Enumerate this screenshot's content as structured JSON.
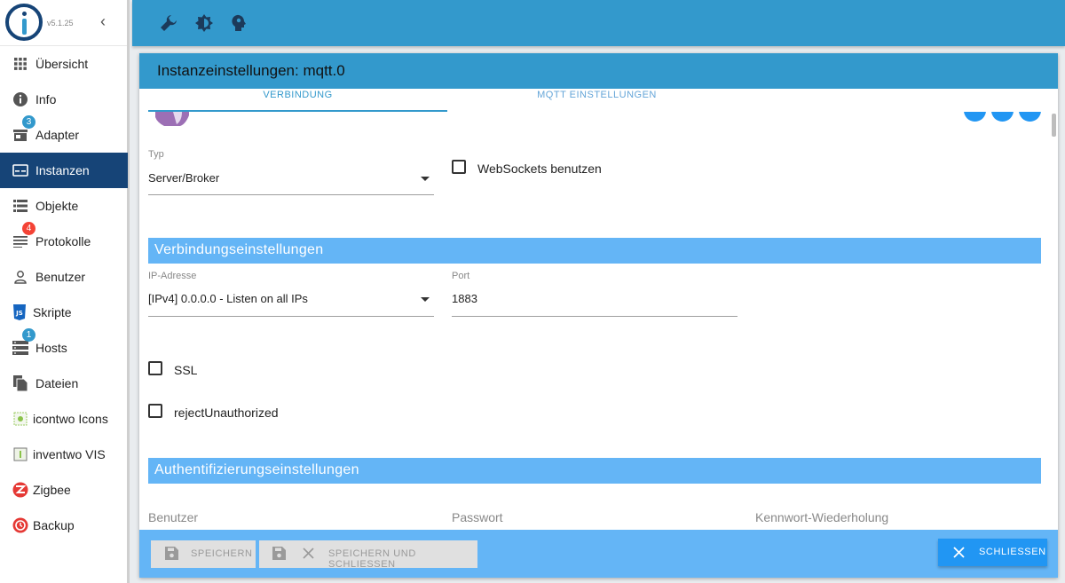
{
  "app": {
    "version": "v5.1.25"
  },
  "sidebar": {
    "items": [
      {
        "label": "Übersicht",
        "icon": "apps-grid-icon"
      },
      {
        "label": "Info",
        "icon": "info-icon"
      },
      {
        "label": "Adapter",
        "icon": "store-icon",
        "badge": "3"
      },
      {
        "label": "Instanzen",
        "icon": "instances-icon"
      },
      {
        "label": "Objekte",
        "icon": "list-icon"
      },
      {
        "label": "Protokolle",
        "icon": "log-icon",
        "badge": "4"
      },
      {
        "label": "Benutzer",
        "icon": "user-icon"
      },
      {
        "label": "Skripte",
        "icon": "javascript-icon"
      },
      {
        "label": "Hosts",
        "icon": "server-icon",
        "badge": "1"
      },
      {
        "label": "Dateien",
        "icon": "files-icon"
      },
      {
        "label": "icontwo Icons",
        "icon": "icontwo-icon"
      },
      {
        "label": "inventwo VIS",
        "icon": "inventwo-icon"
      },
      {
        "label": "Zigbee",
        "icon": "zigbee-icon"
      },
      {
        "label": "Backup",
        "icon": "backup-icon"
      }
    ],
    "active_index": 3
  },
  "colors": {
    "topbar": "#3399cc",
    "sidebar_active": "#164477",
    "section_header": "#64b5f6",
    "badge_blue": "#3399cc",
    "badge_red": "#f44336",
    "primary_button": "#2196f3"
  },
  "dialog": {
    "title": "Instanzeinstellungen: mqtt.0",
    "tabs": [
      {
        "label": "VERBINDUNG",
        "active": true
      },
      {
        "label": "MQTT EINSTELLUNGEN",
        "active": false
      }
    ],
    "type": {
      "label": "Typ",
      "value": "Server/Broker"
    },
    "websockets_label": "WebSockets benutzen",
    "connection_section": "Verbindungseinstellungen",
    "ip": {
      "label": "IP-Adresse",
      "value": "[IPv4] 0.0.0.0 - Listen on all IPs"
    },
    "port": {
      "label": "Port",
      "value": "1883"
    },
    "ssl_label": "SSL",
    "reject_label": "rejectUnauthorized",
    "auth_section": "Authentifizierungseinstellungen",
    "user_label": "Benutzer",
    "password_label": "Passwort",
    "password_repeat_label": "Kennwort-Wiederholung"
  },
  "footer": {
    "save_label": "SPEICHERN",
    "save_close_label": "SPEICHERN UND SCHLIESSEN",
    "close_label": "SCHLIESSEN"
  }
}
